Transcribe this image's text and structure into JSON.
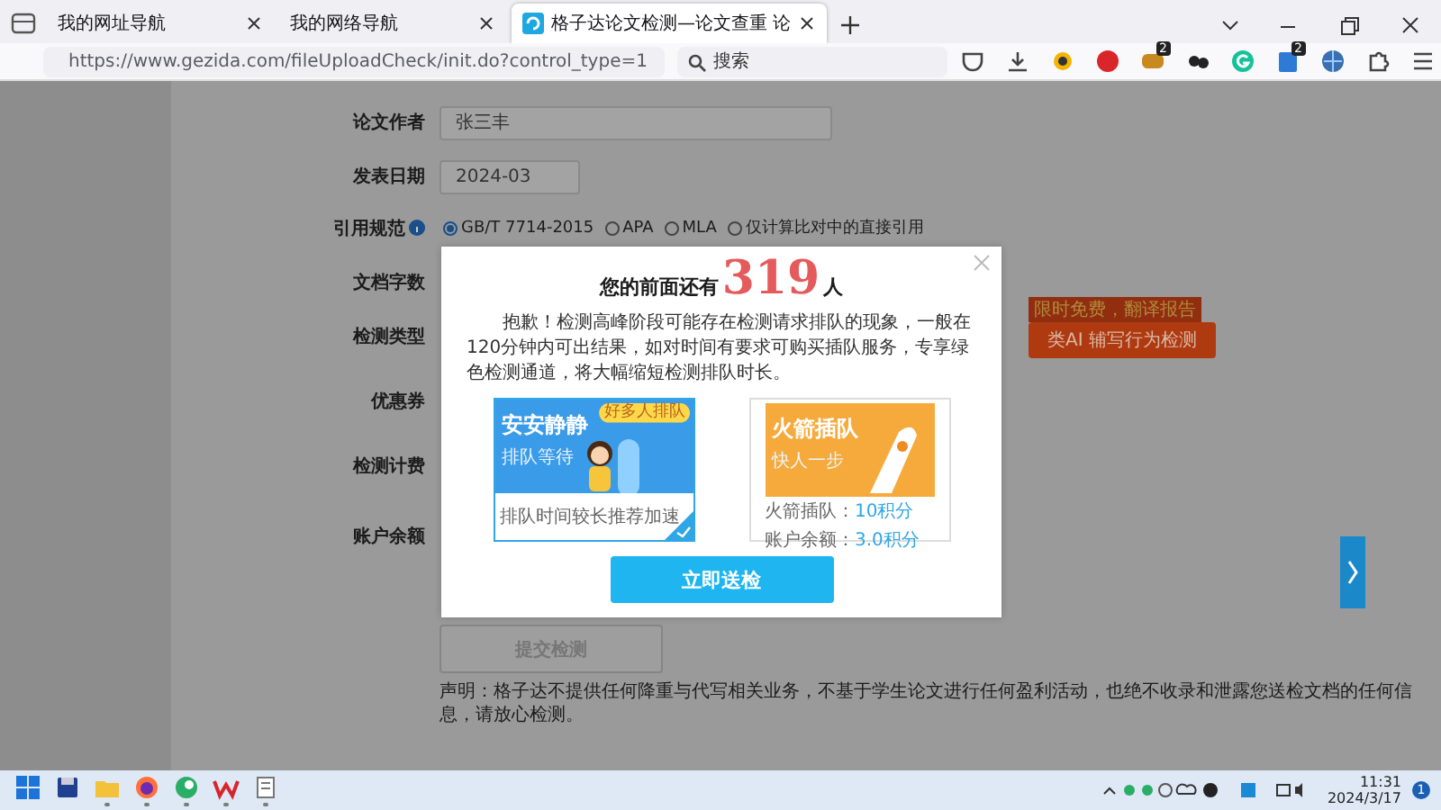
{
  "browser": {
    "tabs": [
      {
        "title": "我的网址导航",
        "selected": false
      },
      {
        "title": "我的网络导航",
        "selected": false
      },
      {
        "title": "格子达论文检测—论文查重 论",
        "selected": true
      }
    ],
    "url": "https://www.gezida.com/fileUploadCheck/init.do?control_type=1",
    "search": {
      "placeholder": "搜索"
    },
    "extensions": [
      {
        "kind": "pocket"
      },
      {
        "kind": "download"
      },
      {
        "kind": "ring"
      },
      {
        "kind": "block"
      },
      {
        "kind": "game",
        "badge": "2"
      },
      {
        "kind": "paw"
      },
      {
        "kind": "grammar"
      },
      {
        "kind": "note",
        "badge": "2"
      },
      {
        "kind": "globe"
      },
      {
        "kind": "puzzle"
      },
      {
        "kind": "menu"
      }
    ]
  },
  "form": {
    "fields": [
      {
        "label": "论文作者",
        "kind": "input",
        "value": "张三丰"
      },
      {
        "label": "发表日期",
        "kind": "input",
        "value": "2024-03"
      },
      {
        "label": "引用规范",
        "kind": "radios",
        "options": [
          {
            "label": "GB/T 7714-2015",
            "selected": true
          },
          {
            "label": "APA",
            "selected": false
          },
          {
            "label": "MLA",
            "selected": false
          },
          {
            "label": "仅计算比对中的直接引用",
            "selected": false
          }
        ]
      },
      {
        "label": "文档字数",
        "kind": "blank"
      },
      {
        "label": "检测类型",
        "kind": "action",
        "button": "类AI 辅写行为检测",
        "tag": "限时免费，翻译报告"
      },
      {
        "label": "优惠券",
        "kind": "blank"
      },
      {
        "label": "检测计费",
        "kind": "blank"
      },
      {
        "label": "账户余额",
        "kind": "blank"
      }
    ],
    "submit": "提交检测",
    "notice": "声明：格子达不提供任何降重与代写相关业务，不基于学生论文进行任何盈利活动，也绝不收录和泄露您送检文档的任何信息，请放心检测。"
  },
  "modal": {
    "title_before": "您的前面还有",
    "count": "319",
    "title_after": "人",
    "message": "抱歉！检测高峰阶段可能存在检测请求排队的现象，一般在120分钟内可出结果，如对时间有要求可购买插队服务，专享绿色检测通道，将大幅缩短检测排队时长。",
    "options": [
      {
        "kind": "queue",
        "heading": "安安静静",
        "subheading": "排队等待",
        "badge": "好多人排队",
        "caption": "排队时间较长推荐加速",
        "selected": true
      },
      {
        "kind": "rocket",
        "heading": "火箭插队",
        "subheading": "快人一步",
        "lines": [
          {
            "label": "火箭插队：",
            "value": "10积分"
          },
          {
            "label": "账户余额：",
            "value": "3.0积分"
          }
        ],
        "selected": false
      }
    ],
    "button": "立即送检"
  },
  "taskbar": {
    "apps": [
      {
        "kind": "start",
        "running": false
      },
      {
        "kind": "save",
        "running": false
      },
      {
        "kind": "folder",
        "running": true
      },
      {
        "kind": "browser",
        "running": true
      },
      {
        "kind": "chat",
        "running": true
      },
      {
        "kind": "office",
        "running": true
      },
      {
        "kind": "notepad",
        "running": true
      }
    ],
    "time": "11:31",
    "date": "2024/3/17",
    "notifications": "1"
  }
}
